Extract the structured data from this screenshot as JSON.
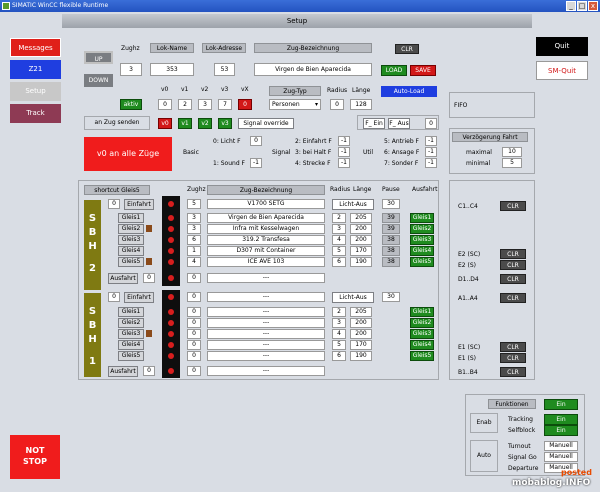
{
  "window": {
    "title": "SIMATIC WinCC flexible Runtime",
    "min": "_",
    "max": "□",
    "close": "x"
  },
  "page_title": "Setup",
  "nav": {
    "messages": "Messages",
    "z21": "Z21",
    "setup": "Setup",
    "track": "Track",
    "quit": "Quit",
    "sm_quit": "SM-Quit",
    "not_stop_1": "NOT",
    "not_stop_2": "STOP"
  },
  "train": {
    "up": "UP",
    "down": "DOWN",
    "zughz_lbl": "Zughz",
    "zughz": "3",
    "lokname_lbl": "Lok-Name",
    "lokname": "353",
    "lokadr_lbl": "Lok-Adresse",
    "lokadr": "53",
    "zugbez_lbl": "Zug-Bezeichnung",
    "zugbez": "Virgen de Bien Aparecida",
    "clr": "CLR",
    "load": "LOAD",
    "save": "SAVE",
    "aktiv": "aktiv"
  },
  "speeds": {
    "labels": [
      "v0",
      "v1",
      "v2",
      "v3",
      "vX"
    ],
    "values": [
      "0",
      "2",
      "3",
      "7",
      "0"
    ]
  },
  "zugtyp": {
    "label": "Zug-Typ",
    "value": "Personen",
    "radius_lbl": "Radius",
    "laenge_lbl": "Länge",
    "radius": "0",
    "laenge": "128",
    "autoload": "Auto-Load"
  },
  "send": {
    "an_zug": "an Zug senden",
    "v0": "v0",
    "v1": "v1",
    "v2": "v2",
    "v3": "v3",
    "override": "Signal override",
    "alle": "v0 an alle Züge",
    "f_ein": "F_ Ein",
    "f_aus": "F_ Aus",
    "f_val": "0"
  },
  "basic": {
    "label": "Basic",
    "f0": "0: Licht F",
    "f0v": "0",
    "f1": "1: Sound F",
    "f1v": "-1"
  },
  "signal": {
    "label": "Signal",
    "f2": "2: Einfahrt F",
    "f2v": "-1",
    "f3": "3: bei Halt F",
    "f3v": "-1",
    "f4": "4: Strecke F",
    "f4v": "-1"
  },
  "util": {
    "label": "Util",
    "f5": "5: Antrieb F",
    "f5v": "-1",
    "f6": "6: Ansage F",
    "f6v": "-1",
    "f7": "7: Sonder F",
    "f7v": "-1"
  },
  "fifo": {
    "label": "FIFO"
  },
  "delay": {
    "title": "Verzögerung Fahrt",
    "max_lbl": "maximal",
    "max": "10",
    "min_lbl": "minimal",
    "min": "5"
  },
  "table": {
    "shortcut": "shortcut Gleis5",
    "zughz": "Zughz",
    "zugbez": "Zug-Bezeichnung",
    "radius": "Radius",
    "laenge": "Länge",
    "pause": "Pause",
    "ausfahrt": "Ausfahrt"
  },
  "sbh2": {
    "letters": [
      "S",
      "B",
      "H",
      "2"
    ],
    "einfahrt": "Einfahrt",
    "einfahrt_v": "0",
    "ein_zughz": "5",
    "ein_name": "V1700 SETG",
    "ein_mode": "Licht-Aus",
    "ein_pause": "30",
    "rows": [
      {
        "g": "Gleis1",
        "z": "3",
        "n": "Virgen de Bien Aparecida",
        "r": "2",
        "l": "205",
        "p": "39",
        "a": "Gleis1"
      },
      {
        "g": "Gleis2",
        "z": "3",
        "n": "Infra mit Kesselwagen",
        "r": "3",
        "l": "200",
        "p": "39",
        "a": "Gleis2"
      },
      {
        "g": "Gleis3",
        "z": "6",
        "n": "319.2 Transfesa",
        "r": "4",
        "l": "200",
        "p": "38",
        "a": "Gleis3"
      },
      {
        "g": "Gleis4",
        "z": "1",
        "n": "D307 mit Container",
        "r": "5",
        "l": "170",
        "p": "38",
        "a": "Gleis4"
      },
      {
        "g": "Gleis5",
        "z": "4",
        "n": "ICE AVE 103",
        "r": "6",
        "l": "190",
        "p": "38",
        "a": "Gleis5"
      }
    ],
    "ausfahrt": "Ausfahrt",
    "aus_v": "0",
    "aus_zughz": "0",
    "aus_name": "---"
  },
  "sbh1": {
    "letters": [
      "S",
      "B",
      "H",
      "1"
    ],
    "einfahrt": "Einfahrt",
    "einfahrt_v": "0",
    "ein_zughz": "0",
    "ein_name": "---",
    "ein_mode": "Licht-Aus",
    "ein_pause": "30",
    "rows": [
      {
        "g": "Gleis1",
        "z": "0",
        "n": "---",
        "r": "2",
        "l": "205",
        "a": "Gleis1"
      },
      {
        "g": "Gleis2",
        "z": "0",
        "n": "---",
        "r": "3",
        "l": "200",
        "a": "Gleis2"
      },
      {
        "g": "Gleis3",
        "z": "0",
        "n": "---",
        "r": "4",
        "l": "200",
        "a": "Gleis3"
      },
      {
        "g": "Gleis4",
        "z": "0",
        "n": "---",
        "r": "5",
        "l": "170",
        "a": "Gleis4"
      },
      {
        "g": "Gleis5",
        "z": "0",
        "n": "---",
        "r": "6",
        "l": "190",
        "a": "Gleis5"
      }
    ],
    "ausfahrt": "Ausfahrt",
    "aus_v": "0",
    "aus_zughz": "0",
    "aus_name": "---"
  },
  "blocks": {
    "c1c4": "C1..C4",
    "e2sc": "E2 (SC)",
    "e2s": "E2 (S)",
    "d1d4": "D1..D4",
    "a1a4": "A1..A4",
    "e1sc": "E1 (SC)",
    "e1s": "E1 (S)",
    "b1b4": "B1..B4",
    "clr": "CLR"
  },
  "functions": {
    "title": "Funktionen",
    "title_v": "Ein",
    "enab": "Enab",
    "tracking": "Tracking",
    "tracking_v": "Ein",
    "selfblock": "Selfblock",
    "selfblock_v": "Ein",
    "auto": "Auto",
    "turnout": "Turnout",
    "turnout_v": "Manuell",
    "signalgo": "Signal Go",
    "signalgo_v": "Manuell",
    "departure": "Departure",
    "departure_v": "Manuell"
  },
  "watermark": {
    "posted": "posted",
    "site": "mobablog.INFO"
  }
}
